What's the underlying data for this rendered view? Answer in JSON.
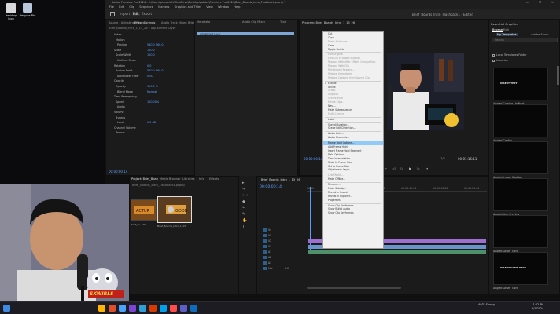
{
  "desktop": {
    "icons": [
      {
        "label": "desktop icon",
        "color": "#d9d9d9"
      },
      {
        "label": "Recycle Bin",
        "color": "#b8c7d9"
      }
    ]
  },
  "window": {
    "title": "Adobe Premiere Pro 2024 - C:\\Users\\pinnaclefx\\OneDrive\\Desktop\\Adobe\\Premiere Pro\\2024\\Brief_Boards_Intro_Flashback.prproj *",
    "controls": "— ❐ ✕"
  },
  "menubar": [
    "File",
    "Edit",
    "Clip",
    "Sequence",
    "Markers",
    "Graphics and Titles",
    "View",
    "Window",
    "Help"
  ],
  "workspaces": {
    "items": [
      "Import",
      "Edit",
      "Export"
    ],
    "active": "Edit",
    "project_title": "Brief_Boards_Intro_Flashback1 - Edited"
  },
  "effect_controls": {
    "tabs": [
      "Effect Controls",
      "Audio Track Mixer: Brief_Boards_Intro_1_15_26",
      "Metadata",
      "Audio Clip Mixer",
      "Text"
    ],
    "source_label": "Source - Adjustment Layer",
    "sequence_label": "Brief_Boards_Intro_1_15_26 * Adjustment Layer",
    "clip_label": "Adjustment Layer",
    "rows": [
      {
        "label": "Video",
        "value": ""
      },
      {
        "label": "Motion",
        "value": ""
      },
      {
        "label": "Position",
        "value": "540.0   960.0"
      },
      {
        "label": "Scale",
        "value": "100.0"
      },
      {
        "label": "Scale Width",
        "value": "100.0"
      },
      {
        "label": "Uniform Scale",
        "value": ""
      },
      {
        "label": "Rotation",
        "value": "0.0"
      },
      {
        "label": "Anchor Point",
        "value": "540.0   960.0"
      },
      {
        "label": "Anti-flicker Filter",
        "value": "0.00"
      },
      {
        "label": "Opacity",
        "value": ""
      },
      {
        "label": "Opacity",
        "value": "100.0 %"
      },
      {
        "label": "Blend Mode",
        "value": "Normal"
      },
      {
        "label": "Time Remapping",
        "value": ""
      },
      {
        "label": "Speed",
        "value": "100.00%"
      },
      {
        "label": "Audio",
        "value": ""
      },
      {
        "label": "Volume",
        "value": ""
      },
      {
        "label": "Bypass",
        "value": ""
      },
      {
        "label": "Level",
        "value": "0.0 dB"
      },
      {
        "label": "Channel Volume",
        "value": ""
      },
      {
        "label": "Panner",
        "value": ""
      }
    ],
    "timecode": "00:00:00:14"
  },
  "program": {
    "header": "Program: Brief_Boards_Intro_1_15_26",
    "timecode_left": "00:00:00:14",
    "fit": "1/2",
    "timecode_right": "00:01:16:11",
    "controls": "⇤ ◁ ▷ ▶ ▷ ⇥"
  },
  "context_menu": {
    "items": [
      {
        "label": "Cut",
        "disabled": false,
        "sep_before": false,
        "checked": false,
        "highlight": false
      },
      {
        "label": "Copy",
        "disabled": false
      },
      {
        "label": "Paste Attributes...",
        "disabled": true
      },
      {
        "label": "Clear",
        "disabled": false
      },
      {
        "label": "Ripple Delete",
        "disabled": false
      },
      {
        "label": "Edit Original",
        "disabled": true,
        "sep_before": true
      },
      {
        "label": "Edit Clip in Adobe Audition",
        "disabled": true
      },
      {
        "label": "Replace With After Effects Composition",
        "disabled": true
      },
      {
        "label": "Replace With Clip",
        "disabled": true
      },
      {
        "label": "Render and Replace...",
        "disabled": true
      },
      {
        "label": "Restore Unrendered",
        "disabled": true
      },
      {
        "label": "Restore Captions from Source Clip",
        "disabled": true
      },
      {
        "label": "Enable",
        "disabled": false,
        "checked": true,
        "sep_before": true
      },
      {
        "label": "Unlink",
        "disabled": false
      },
      {
        "label": "Group",
        "disabled": true
      },
      {
        "label": "Ungroup",
        "disabled": true
      },
      {
        "label": "Synchronize",
        "disabled": true
      },
      {
        "label": "Merge Clips...",
        "disabled": true
      },
      {
        "label": "Nest...",
        "disabled": false
      },
      {
        "label": "Make Subsequence",
        "disabled": false
      },
      {
        "label": "Multi-Camera",
        "disabled": true
      },
      {
        "label": "Label",
        "disabled": false,
        "sep_before": true
      },
      {
        "label": "Speed/Duration...",
        "disabled": false,
        "sep_before": true
      },
      {
        "label": "Scene Edit Detection...",
        "disabled": false
      },
      {
        "label": "Audio Gain...",
        "disabled": false,
        "sep_before": true
      },
      {
        "label": "Audio Channels...",
        "disabled": false
      },
      {
        "label": "Frame Hold Options...",
        "disabled": false,
        "sep_before": true,
        "highlight": true
      },
      {
        "label": "Add Frame Hold",
        "disabled": false
      },
      {
        "label": "Insert Frame Hold Segment",
        "disabled": false
      },
      {
        "label": "Field Options...",
        "disabled": false
      },
      {
        "label": "Time Interpolation",
        "disabled": false
      },
      {
        "label": "Scale to Frame Size",
        "disabled": false
      },
      {
        "label": "Set to Frame Size",
        "disabled": false
      },
      {
        "label": "Adjustment Layer",
        "disabled": false
      },
      {
        "label": "Link Media...",
        "disabled": true,
        "sep_before": true
      },
      {
        "label": "Make Offline...",
        "disabled": false
      },
      {
        "label": "Rename...",
        "disabled": false,
        "sep_before": true
      },
      {
        "label": "Make Subclip...",
        "disabled": false
      },
      {
        "label": "Reveal in Project",
        "disabled": false
      },
      {
        "label": "Reveal in Explorer...",
        "disabled": false
      },
      {
        "label": "Properties",
        "disabled": false
      },
      {
        "label": "Show Clip Keyframes",
        "disabled": false,
        "sep_before": true
      },
      {
        "label": "Show Bullet Audio",
        "disabled": false
      },
      {
        "label": "Show Clip Keyframes",
        "disabled": false
      }
    ]
  },
  "essential_graphics": {
    "title": "Essential Graphics",
    "tabs": [
      "Browse",
      "Edit"
    ],
    "sub_tabs": [
      "My Templates",
      "Adobe Stock"
    ],
    "search_placeholder": "Search",
    "checks": [
      "Local Templates Folder",
      "Libraries"
    ],
    "templates": [
      {
        "label": "",
        "inner": "INSERT TEXT"
      },
      {
        "label": "Angled Coming Up Next",
        "inner": ""
      },
      {
        "label": "Angled Credits",
        "inner": ""
      },
      {
        "label": "Angled Image Caption",
        "inner": ""
      },
      {
        "label": "Angled Line Preview",
        "inner": ""
      },
      {
        "label": "Angled Lower Third",
        "inner": "INSERT NAME HERE"
      },
      {
        "label": "Angled Lower Third",
        "inner": ""
      }
    ]
  },
  "project": {
    "tabs": [
      "Project: Brief_Boards_Intro_Flashback1",
      "Media Browser",
      "Libraries",
      "Info",
      "Effects"
    ],
    "path": "Brief_Boards_Intro_Flashback1.prproj",
    "thumbs": [
      {
        "label": "Brief_Bo...26",
        "color": "#8a5a2a"
      },
      {
        "label": "Brief_Boards_Intro_1_15",
        "color": "#6b4c2a"
      },
      {
        "label": "Adjustment Layer",
        "color": "#555"
      }
    ]
  },
  "timeline": {
    "tab": "Brief_Boards_Intro_1_15_26",
    "timecode": "00:00:00:14",
    "ruler": [
      "00:00",
      "00:00:04:00",
      "00:00:08:00",
      "00:00:12:00",
      "00:00:16:00",
      "00:00:20:00"
    ],
    "tracks": [
      "V4",
      "V3",
      "V2",
      "V1",
      "A1",
      "A2",
      "A3",
      "Mix"
    ],
    "mix_value": "0.0",
    "clip_colors": {
      "adjustment": "#9d6fd1",
      "video": "#6a93c9",
      "audio": "#4f8f6a"
    }
  },
  "taskbar": {
    "weather": "49°F Sunny",
    "time": "1:02 PM",
    "date": "2/1/2024",
    "colors": [
      "#3c8ce7",
      "#ffb400",
      "#e04e2a",
      "#4aa3ff",
      "#7b46d8",
      "#2d9fd9",
      "#d83b01",
      "#00a2ed",
      "#ff4d4d",
      "#5b5fc7",
      "#0f6cbd"
    ]
  },
  "watermark": "SKWIRLS"
}
